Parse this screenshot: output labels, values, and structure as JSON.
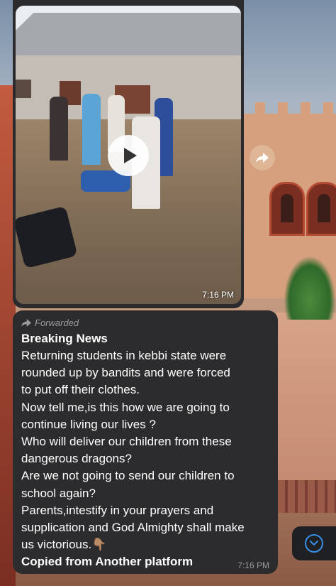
{
  "video_message": {
    "time": "7:16 PM",
    "thumbnail_icon": "play-icon"
  },
  "share_button": {
    "icon": "share-arrow-icon"
  },
  "text_message": {
    "forwarded_label": "Forwarded",
    "forwarded_icon": "forward-arrow-icon",
    "heading": "Breaking News",
    "lines": [
      "Returning students in kebbi state were",
      "rounded up by bandits and were forced",
      "to put off their clothes.",
      "Now tell me,is this how we are going to",
      "continue living our lives ?",
      "Who will deliver our children from these",
      "dangerous dragons?",
      "Are we not going to send our children to",
      "school again?",
      "Parents,intestify in your prayers and",
      "supplication and God Almighty shall make",
      "us victorious.👇🏽"
    ],
    "footer": "Copied from Another platform",
    "time": "7:16 PM"
  },
  "scroll_down_button": {
    "icon": "chevron-down-icon"
  },
  "colors": {
    "bubble": "#2c2c2e",
    "accent": "#3a8ee6",
    "meta_text": "#9a9aa0"
  }
}
